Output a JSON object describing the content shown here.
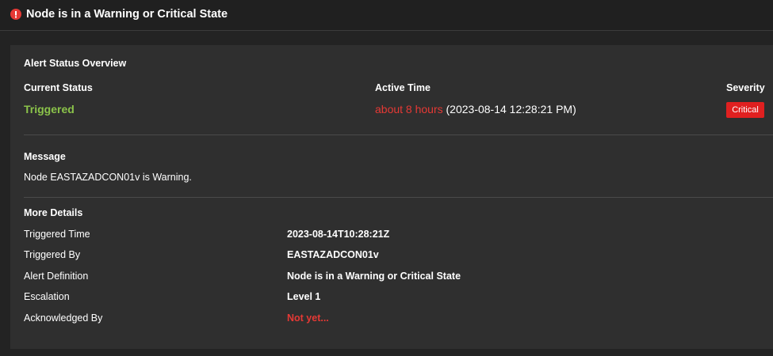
{
  "header": {
    "title": "Node is in a Warning or Critical State",
    "icon": "alert-exclamation-icon"
  },
  "overview": {
    "section_title": "Alert Status Overview",
    "current_status_label": "Current Status",
    "current_status_value": "Triggered",
    "active_time_label": "Active Time",
    "active_time_relative": "about 8 hours",
    "active_time_absolute": "(2023-08-14 12:28:21 PM)",
    "severity_label": "Severity",
    "severity_value": "Critical"
  },
  "message": {
    "section_title": "Message",
    "text": "Node EASTAZADCON01v is Warning."
  },
  "details": {
    "section_title": "More Details",
    "rows": [
      {
        "label": "Triggered Time",
        "value": "2023-08-14T10:28:21Z"
      },
      {
        "label": "Triggered By",
        "value": "EASTAZADCON01v"
      },
      {
        "label": "Alert Definition",
        "value": "Node is in a Warning or Critical State"
      },
      {
        "label": "Escalation",
        "value": "Level 1"
      },
      {
        "label": "Acknowledged By",
        "value": "Not yet..."
      }
    ]
  },
  "colors": {
    "background": "#232323",
    "panel": "#2f2f2f",
    "status_green": "#8bc34a",
    "critical_red": "#e53935"
  }
}
